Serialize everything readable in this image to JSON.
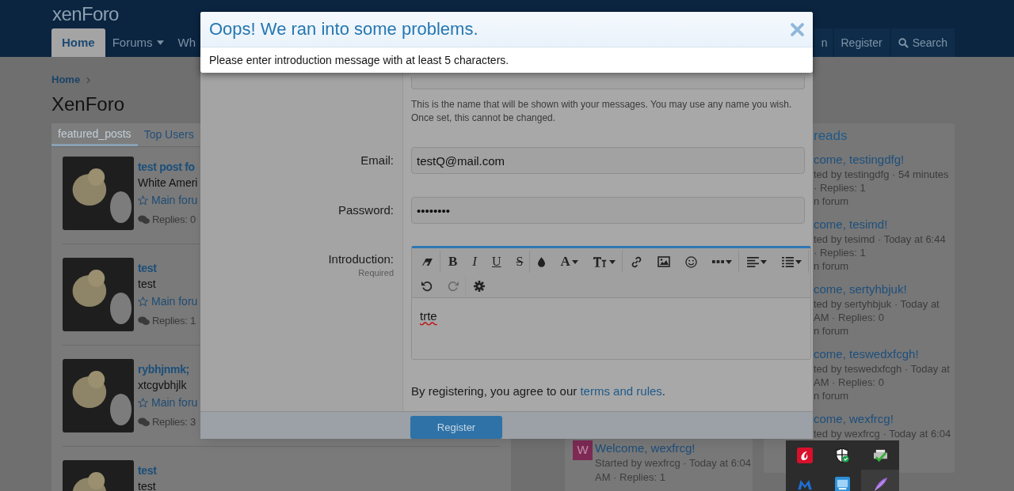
{
  "header": {
    "logo": "xenForo",
    "nav": [
      {
        "label": "Home",
        "selected": true,
        "dropdown": false
      },
      {
        "label": "Forums",
        "selected": false,
        "dropdown": true
      },
      {
        "label": "Wh",
        "selected": false,
        "dropdown": false
      }
    ],
    "account": [
      {
        "label": "n",
        "kind": "link"
      },
      {
        "label": "Register",
        "kind": "link"
      },
      {
        "label": "Search",
        "kind": "search"
      }
    ]
  },
  "breadcrumb": [
    "Home"
  ],
  "page_title": "XenForo",
  "featured": {
    "tabs": [
      {
        "label": "featured_posts",
        "selected": true
      },
      {
        "label": "Top Users",
        "selected": false
      }
    ],
    "posts": [
      {
        "title": "test post fo",
        "snippet": "White Ameri",
        "forum": "Main foru",
        "replies": "Replies: 0"
      },
      {
        "title": "test",
        "snippet": "test",
        "forum": "Main foru",
        "replies": "Replies: 1"
      },
      {
        "title": "rybhjnmk;",
        "snippet": "xtcgvbhjlk",
        "forum": "Main foru",
        "replies": "Replies: 3"
      },
      {
        "title": "test",
        "snippet": "test"
      }
    ]
  },
  "middle_thread": {
    "avatar": "W",
    "title": "Welcome, wexfrcg!",
    "meta": [
      "Started by wexfrcg · Today at 6:04",
      "AM · Replies: 1"
    ]
  },
  "latest_threads": {
    "heading": "reads",
    "items": [
      {
        "title": "come, testingdfg!",
        "meta": [
          "ted by testingdfg · 54 minutes",
          "· Replies: 1",
          "n forum"
        ]
      },
      {
        "title": "come, tesimd!",
        "meta": [
          "ted by tesimd · Today at 6:44",
          "· Replies: 1",
          "n forum"
        ]
      },
      {
        "title": "come, sertyhbjuk!",
        "meta": [
          "ted by sertyhbjuk · Today at",
          "AM · Replies: 0",
          "n forum"
        ]
      },
      {
        "title": "come, teswedxfcgh!",
        "meta": [
          "ted by teswedxfcgh · Today at",
          "AM · Replies: 0",
          "n forum"
        ]
      },
      {
        "title": "come, wexfrcg!",
        "meta": [
          "ted by wexfrcg · Today at 6:04"
        ]
      }
    ]
  },
  "register_dialog": {
    "username": {
      "help": "This is the name that will be shown with your messages. You may use any name you wish. Once set, this cannot be changed."
    },
    "email": {
      "label": "Email:",
      "value": "testQ@mail.com"
    },
    "password": {
      "label": "Password:",
      "value": "••••••••"
    },
    "introduction": {
      "label": "Introduction:",
      "hint": "Required",
      "value": "trte",
      "toolbar": [
        [
          {
            "kind": "icon",
            "dropdown": false,
            "disabled": false,
            "separator_after": true
          },
          {
            "kind": "bold",
            "label": "B",
            "dropdown": false,
            "disabled": false,
            "separator_after": false
          },
          {
            "kind": "italic",
            "label": "I",
            "dropdown": false,
            "disabled": false,
            "separator_after": false
          },
          {
            "kind": "underline",
            "label": "U",
            "dropdown": false,
            "disabled": false,
            "separator_after": false
          },
          {
            "kind": "strike",
            "label": "S",
            "dropdown": false,
            "disabled": false,
            "separator_after": true
          },
          {
            "kind": "icon",
            "dropdown": false,
            "disabled": false,
            "separator_after": false
          },
          {
            "kind": "glyph",
            "label": "A",
            "dropdown": true,
            "disabled": false,
            "separator_after": false
          },
          {
            "kind": "icon",
            "dropdown": true,
            "disabled": false,
            "separator_after": true
          },
          {
            "kind": "icon",
            "dropdown": false,
            "disabled": false,
            "separator_after": false
          },
          {
            "kind": "icon",
            "dropdown": false,
            "disabled": false,
            "separator_after": false
          },
          {
            "kind": "icon",
            "dropdown": false,
            "disabled": false,
            "separator_after": false
          },
          {
            "kind": "icon",
            "dropdown": true,
            "disabled": false,
            "separator_after": true
          },
          {
            "kind": "icon",
            "dropdown": true,
            "disabled": false,
            "separator_after": false
          },
          {
            "kind": "icon",
            "dropdown": true,
            "disabled": false,
            "separator_after": true
          }
        ],
        [
          {
            "kind": "icon",
            "dropdown": false,
            "disabled": false,
            "separator_after": false
          },
          {
            "kind": "icon",
            "dropdown": false,
            "disabled": true,
            "separator_after": true
          },
          {
            "kind": "icon",
            "dropdown": false,
            "disabled": false,
            "separator_after": false
          }
        ]
      ]
    },
    "terms": {
      "before": "By registering, you agree to our ",
      "link": "terms and rules",
      "after": "."
    },
    "submit": "Register"
  },
  "error_dialog": {
    "title": "Oops! We ran into some problems.",
    "message": "Please enter introduction message with at least 5 characters."
  },
  "tray": {
    "items": [
      {
        "selected": false
      },
      {
        "selected": false
      },
      {
        "selected": false
      },
      {
        "selected": false
      },
      {
        "selected": false
      },
      {
        "selected": true
      }
    ]
  }
}
